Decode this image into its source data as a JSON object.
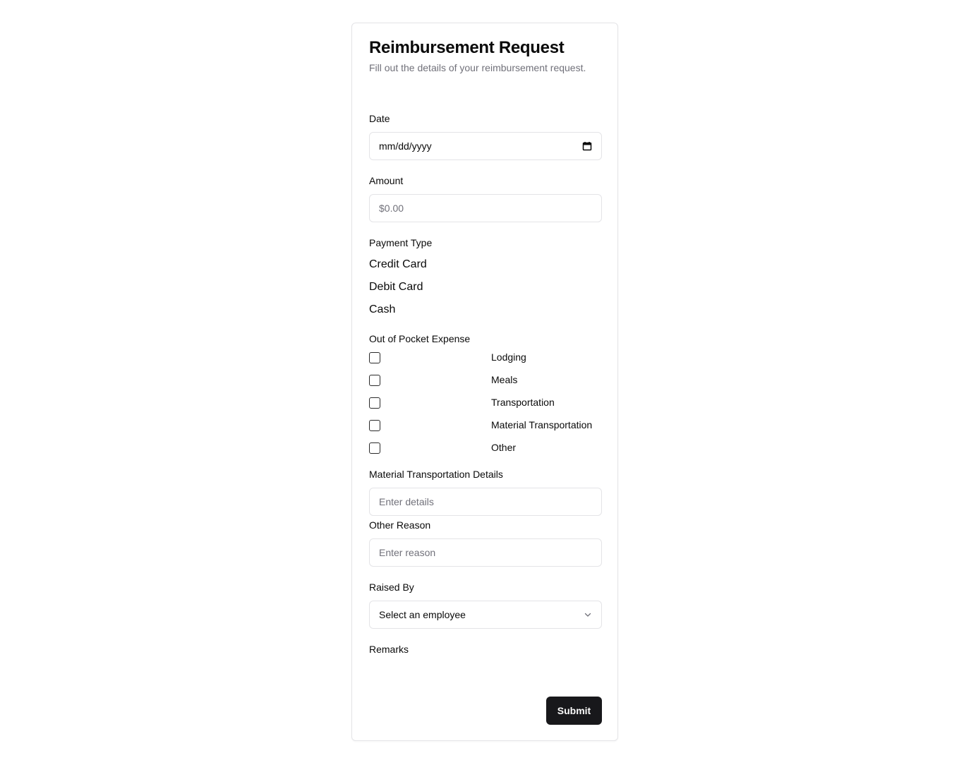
{
  "form": {
    "title": "Reimbursement Request",
    "subtitle": "Fill out the details of your reimbursement request."
  },
  "date": {
    "label": "Date",
    "placeholder": "mm/dd/yyyy",
    "icon": "calendar-icon"
  },
  "amount": {
    "label": "Amount",
    "placeholder": "$0.00"
  },
  "payment_type": {
    "label": "Payment Type",
    "options": [
      "Credit Card",
      "Debit Card",
      "Cash"
    ]
  },
  "out_of_pocket": {
    "label": "Out of Pocket Expense",
    "options": [
      {
        "label": "Lodging",
        "checked": false
      },
      {
        "label": "Meals",
        "checked": false
      },
      {
        "label": "Transportation",
        "checked": false
      },
      {
        "label": "Material Transportation",
        "checked": false
      },
      {
        "label": "Other",
        "checked": false
      }
    ]
  },
  "material_details": {
    "label": "Material Transportation Details",
    "placeholder": "Enter details"
  },
  "other_reason": {
    "label": "Other Reason",
    "placeholder": "Enter reason"
  },
  "raised_by": {
    "label": "Raised By",
    "selected": "Select an employee",
    "icon": "chevron-down-icon"
  },
  "remarks": {
    "label": "Remarks"
  },
  "submit": {
    "label": "Submit"
  },
  "colors": {
    "primary_button": "#18181b",
    "border": "#e4e4e7",
    "muted_text": "#71717a"
  }
}
